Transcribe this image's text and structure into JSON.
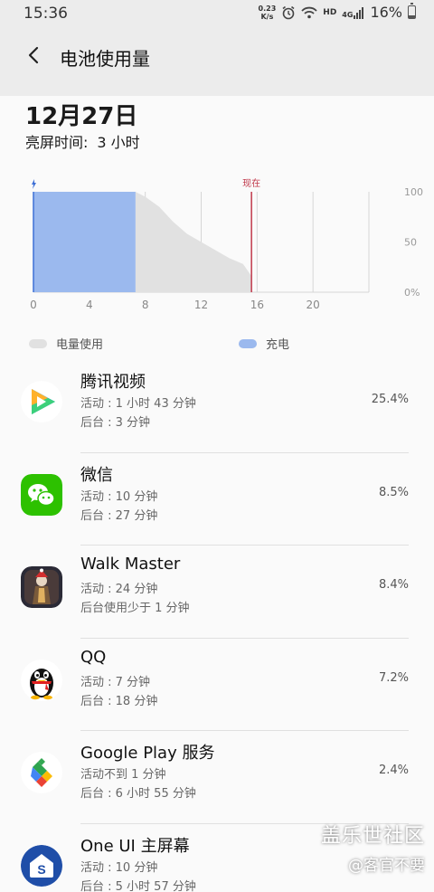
{
  "status_bar": {
    "time": "15:36",
    "speed_value": "0.23",
    "speed_unit": "K/s",
    "hd": "HD",
    "network": "4G",
    "battery": "16%"
  },
  "header": {
    "title": "电池使用量"
  },
  "summary": {
    "date": "12月27日",
    "screen_on_label": "亮屏时间:",
    "screen_on_value": "3 小时"
  },
  "chart_data": {
    "type": "area",
    "x_ticks": [
      "0",
      "4",
      "8",
      "12",
      "16",
      "20"
    ],
    "y_ticks": [
      "100",
      "50",
      "0%"
    ],
    "xlim": [
      0,
      24
    ],
    "ylim": [
      0,
      100
    ],
    "now_label": "现在",
    "now_x": 15.6,
    "series": [
      {
        "name": "充电",
        "x": [
          0,
          7.3
        ],
        "values": [
          100,
          100
        ]
      },
      {
        "name": "电量使用",
        "x": [
          7.3,
          8,
          9,
          10,
          11,
          12,
          13,
          14,
          15,
          15.6
        ],
        "values": [
          100,
          95,
          85,
          70,
          58,
          50,
          42,
          34,
          28,
          16
        ]
      }
    ],
    "colors": {
      "charging": "#9bb9ee",
      "usage": "#e1e1e1",
      "now_line": "#c0394b"
    }
  },
  "legend": {
    "usage": "电量使用",
    "charging": "充电"
  },
  "apps": [
    {
      "name": "腾讯视频",
      "line1": "活动 : 1 小时 43 分钟",
      "line2": "后台 : 3 分钟",
      "percent": "25.4%",
      "icon": "tencent-video-icon"
    },
    {
      "name": "微信",
      "line1": "活动 : 10 分钟",
      "line2": "后台 : 27 分钟",
      "percent": "8.5%",
      "icon": "wechat-icon"
    },
    {
      "name": "Walk Master",
      "line1": "活动 : 24 分钟",
      "line2": "后台使用少于 1 分钟",
      "percent": "8.4%",
      "icon": "walk-master-icon"
    },
    {
      "name": "QQ",
      "line1": "活动 : 7 分钟",
      "line2": "后台 : 18 分钟",
      "percent": "7.2%",
      "icon": "qq-penguin-icon"
    },
    {
      "name": "Google Play 服务",
      "line1": "活动不到 1 分钟",
      "line2": "后台 : 6 小时 55 分钟",
      "percent": "2.4%",
      "icon": "google-play-services-icon"
    },
    {
      "name": "One UI 主屏幕",
      "line1": "活动 : 10 分钟",
      "line2": "后台 : 5 小时 57 分钟",
      "percent": "",
      "icon": "one-ui-home-icon"
    }
  ],
  "watermark": {
    "line1": "盖乐世社区",
    "line2": "@客官不要"
  }
}
